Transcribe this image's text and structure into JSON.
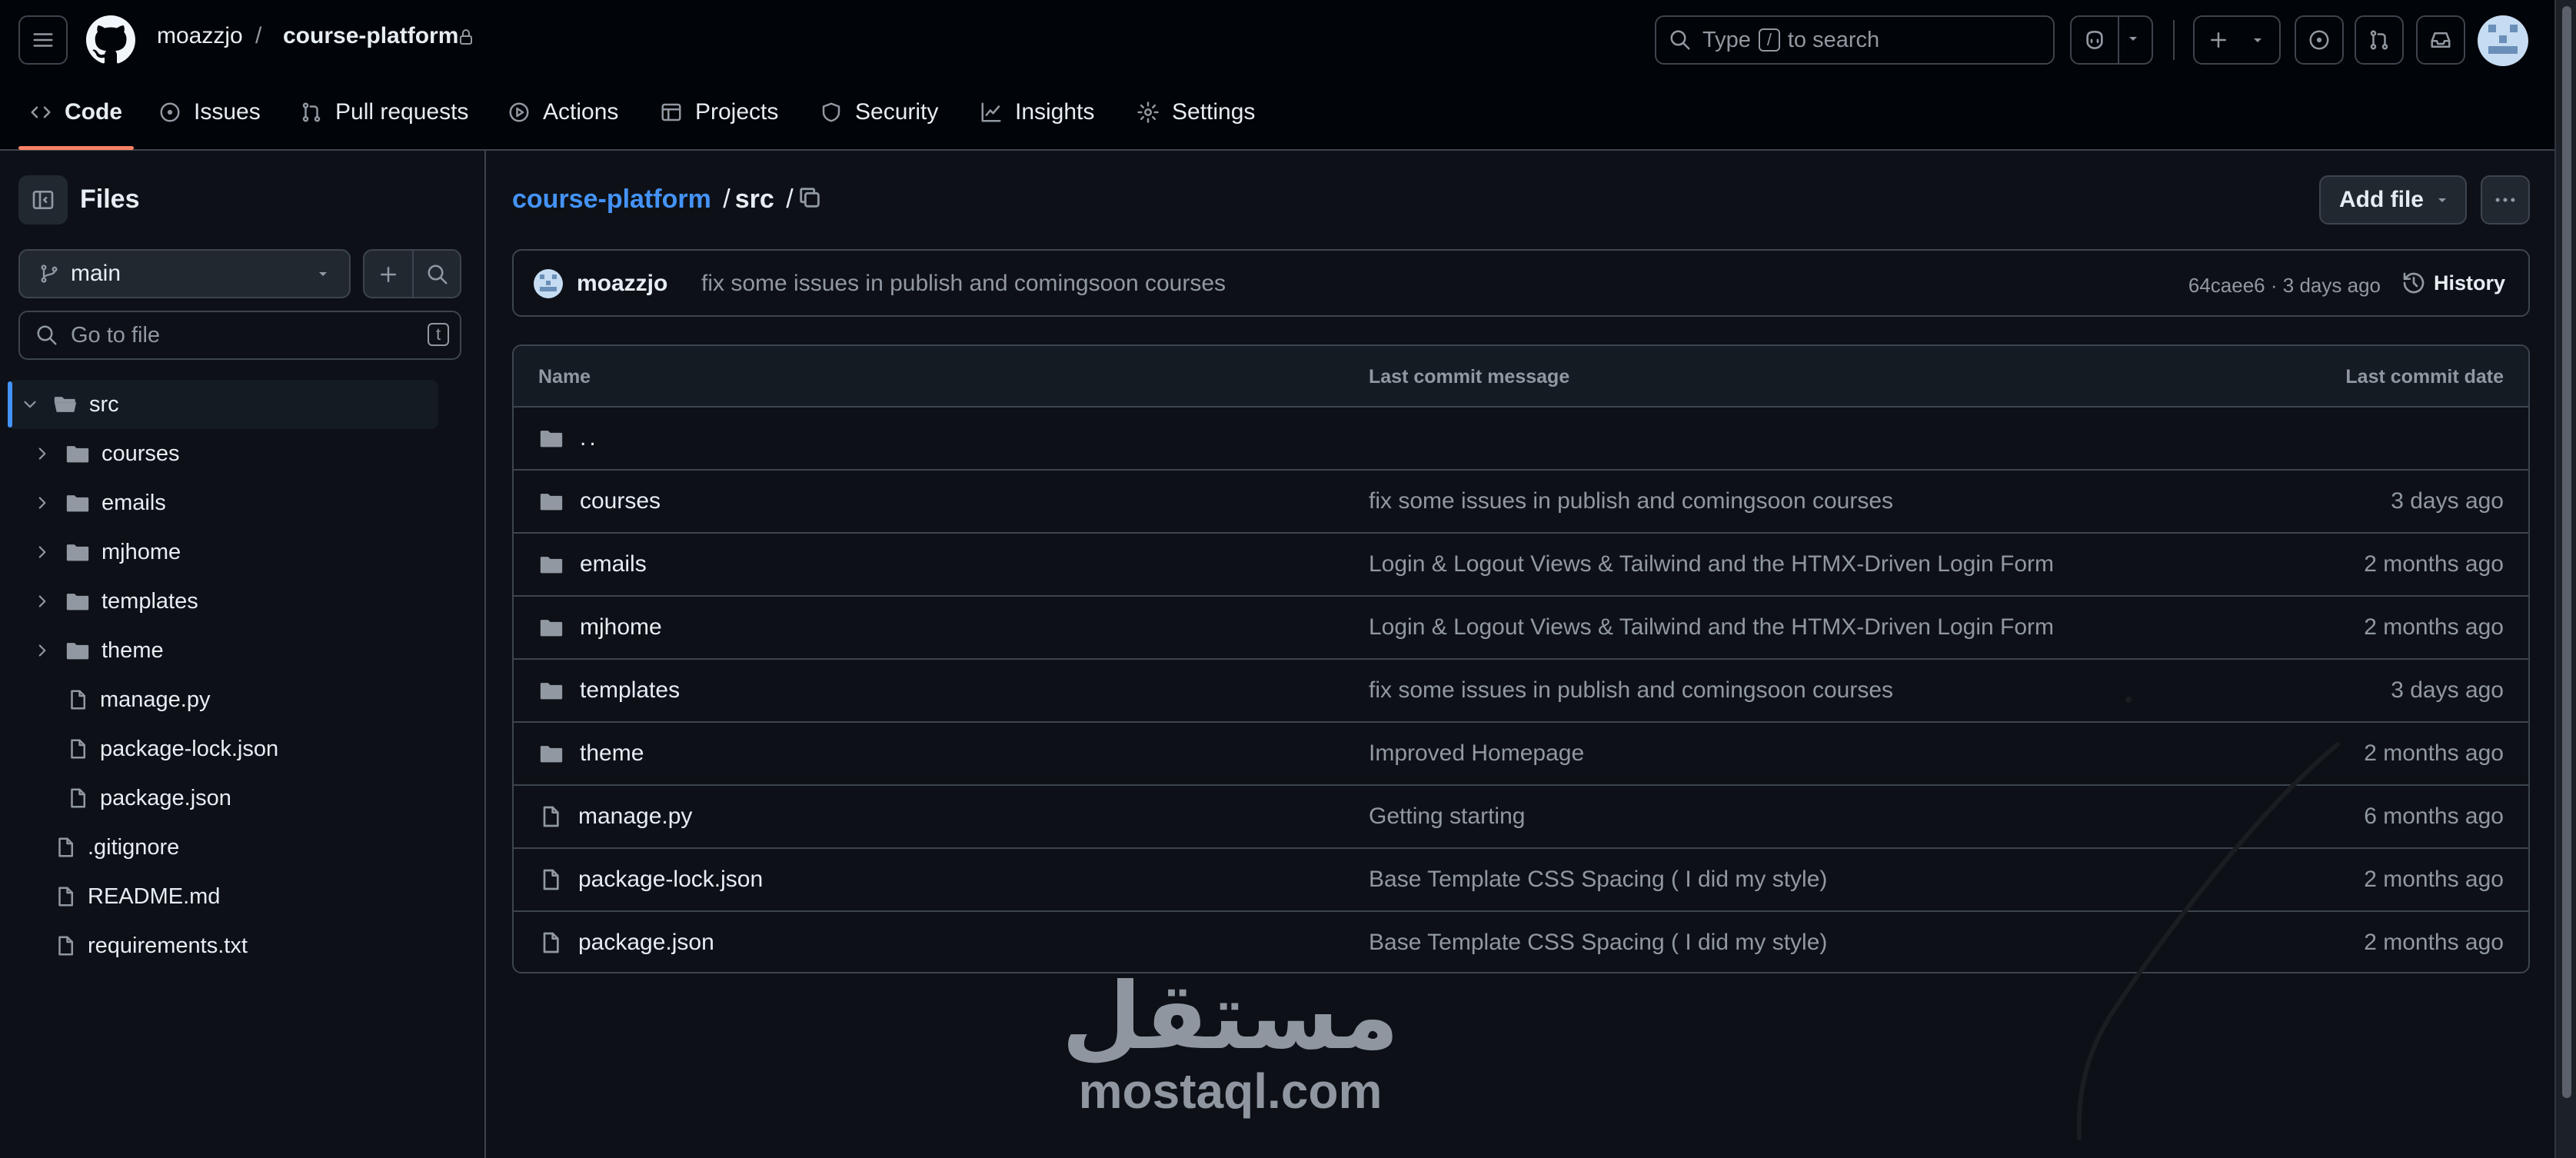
{
  "header": {
    "owner": "moazzjo",
    "separator": "/",
    "repo": "course-platform",
    "search_prefix": "Type",
    "search_key": "/",
    "search_suffix": "to search"
  },
  "tabs": [
    {
      "label": "Code",
      "icon": "code-icon"
    },
    {
      "label": "Issues",
      "icon": "issue-icon"
    },
    {
      "label": "Pull requests",
      "icon": "pull-request-icon"
    },
    {
      "label": "Actions",
      "icon": "play-icon"
    },
    {
      "label": "Projects",
      "icon": "table-icon"
    },
    {
      "label": "Security",
      "icon": "shield-icon"
    },
    {
      "label": "Insights",
      "icon": "graph-icon"
    },
    {
      "label": "Settings",
      "icon": "gear-icon"
    }
  ],
  "sidebar": {
    "title": "Files",
    "branch": "main",
    "go_to_file_placeholder": "Go to file",
    "go_to_file_key": "t",
    "tree": [
      {
        "label": "src",
        "type": "folder-open",
        "expanded": true,
        "selected": true
      },
      {
        "label": "courses",
        "type": "folder"
      },
      {
        "label": "emails",
        "type": "folder"
      },
      {
        "label": "mjhome",
        "type": "folder"
      },
      {
        "label": "templates",
        "type": "folder"
      },
      {
        "label": "theme",
        "type": "folder"
      },
      {
        "label": "manage.py",
        "type": "file"
      },
      {
        "label": "package-lock.json",
        "type": "file"
      },
      {
        "label": "package.json",
        "type": "file"
      },
      {
        "label": ".gitignore",
        "type": "file"
      },
      {
        "label": "README.md",
        "type": "file"
      },
      {
        "label": "requirements.txt",
        "type": "file"
      }
    ]
  },
  "breadcrumb": {
    "repo": "course-platform",
    "sep1": "/",
    "folder": "src",
    "sep2": "/"
  },
  "actions": {
    "add_file": "Add file"
  },
  "commit": {
    "author": "moazzjo",
    "message": "fix some issues in publish and comingsoon courses",
    "sha": "64caee6",
    "dot": "·",
    "time": "3 days ago",
    "history": "History"
  },
  "table": {
    "headers": {
      "name": "Name",
      "message": "Last commit message",
      "date": "Last commit date"
    },
    "parent": "..",
    "rows": [
      {
        "name": "courses",
        "type": "folder",
        "message": "fix some issues in publish and comingsoon courses",
        "date": "3 days ago"
      },
      {
        "name": "emails",
        "type": "folder",
        "message": "Login & Logout Views & Tailwind and the HTMX-Driven Login Form",
        "date": "2 months ago"
      },
      {
        "name": "mjhome",
        "type": "folder",
        "message": "Login & Logout Views & Tailwind and the HTMX-Driven Login Form",
        "date": "2 months ago"
      },
      {
        "name": "templates",
        "type": "folder",
        "message": "fix some issues in publish and comingsoon courses",
        "date": "3 days ago"
      },
      {
        "name": "theme",
        "type": "folder",
        "message": "Improved Homepage",
        "date": "2 months ago"
      },
      {
        "name": "manage.py",
        "type": "file",
        "message": "Getting starting",
        "date": "6 months ago"
      },
      {
        "name": "package-lock.json",
        "type": "file",
        "message": "Base Template CSS Spacing ( I did my style)",
        "date": "2 months ago"
      },
      {
        "name": "package.json",
        "type": "file",
        "message": "Base Template CSS Spacing ( I did my style)",
        "date": "2 months ago"
      }
    ]
  },
  "watermark": {
    "arabic": "مستقل",
    "latin": "mostaql.com"
  },
  "colors": {
    "background": "#0d1117",
    "header_bg": "#010409",
    "border": "#3d444d",
    "link": "#4493f8",
    "muted": "#9198a1",
    "text": "#e6edf3",
    "tab_underline": "#f78166",
    "selected_row": "#151b23",
    "selection_bar": "#4493f8"
  }
}
